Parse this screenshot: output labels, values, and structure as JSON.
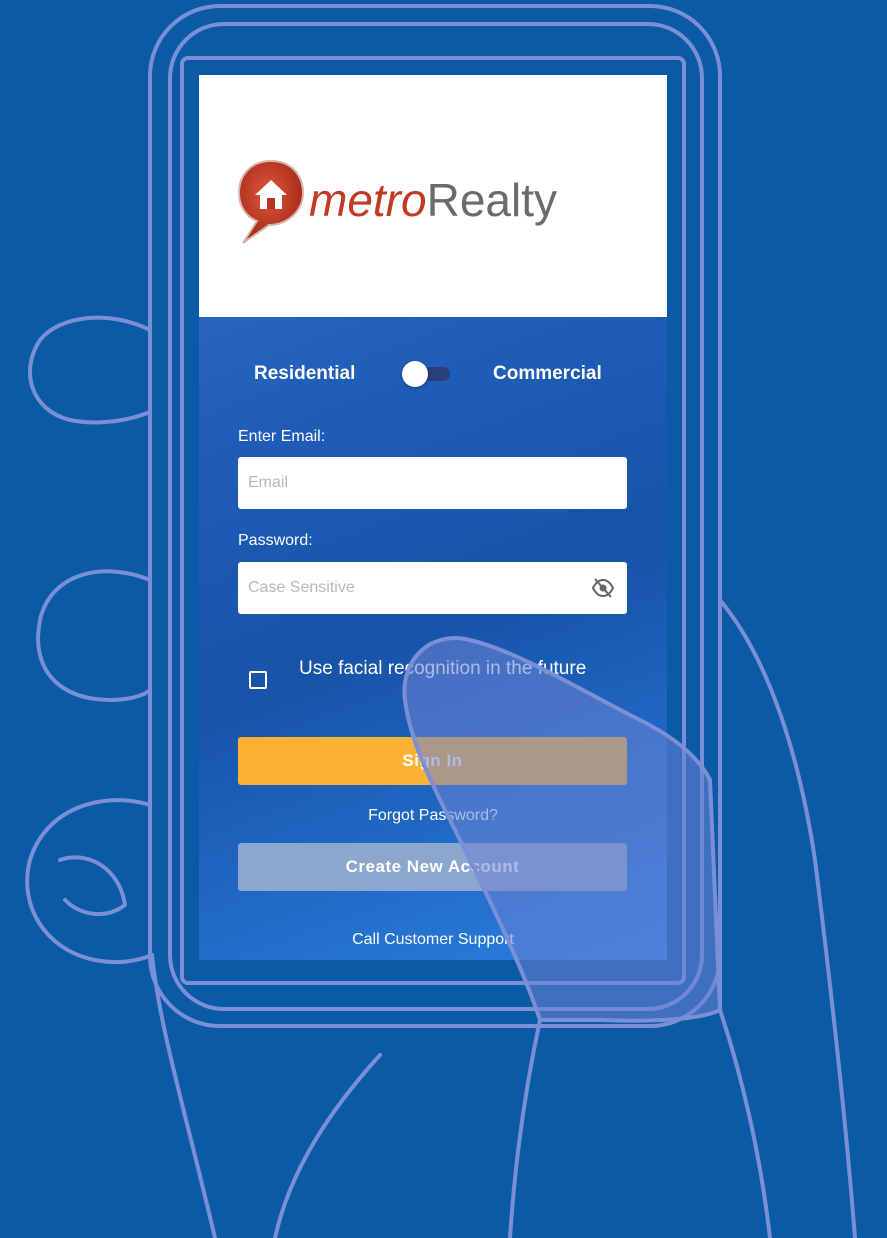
{
  "brand": {
    "name_part1": "metro",
    "name_part2": "Realty"
  },
  "account_type_toggle": {
    "left_label": "Residential",
    "right_label": "Commercial"
  },
  "email": {
    "label": "Enter Email:",
    "placeholder": "Email",
    "value": ""
  },
  "password": {
    "label": "Password:",
    "placeholder": "Case Sensitive",
    "value": ""
  },
  "facial_recognition": {
    "label": "Use facial recognition in the future",
    "checked": false
  },
  "sign_in_button": "Sign In",
  "forgot_password_link": "Forgot Password?",
  "create_account_button": "Create New Account",
  "customer_support_link": "Call Customer Support",
  "colors": {
    "background": "#0a5aa6",
    "sign_in": "#fbb234",
    "create_account": "#8ba6cf",
    "logo_red": "#c23a23",
    "outline": "#7b8fd6"
  }
}
